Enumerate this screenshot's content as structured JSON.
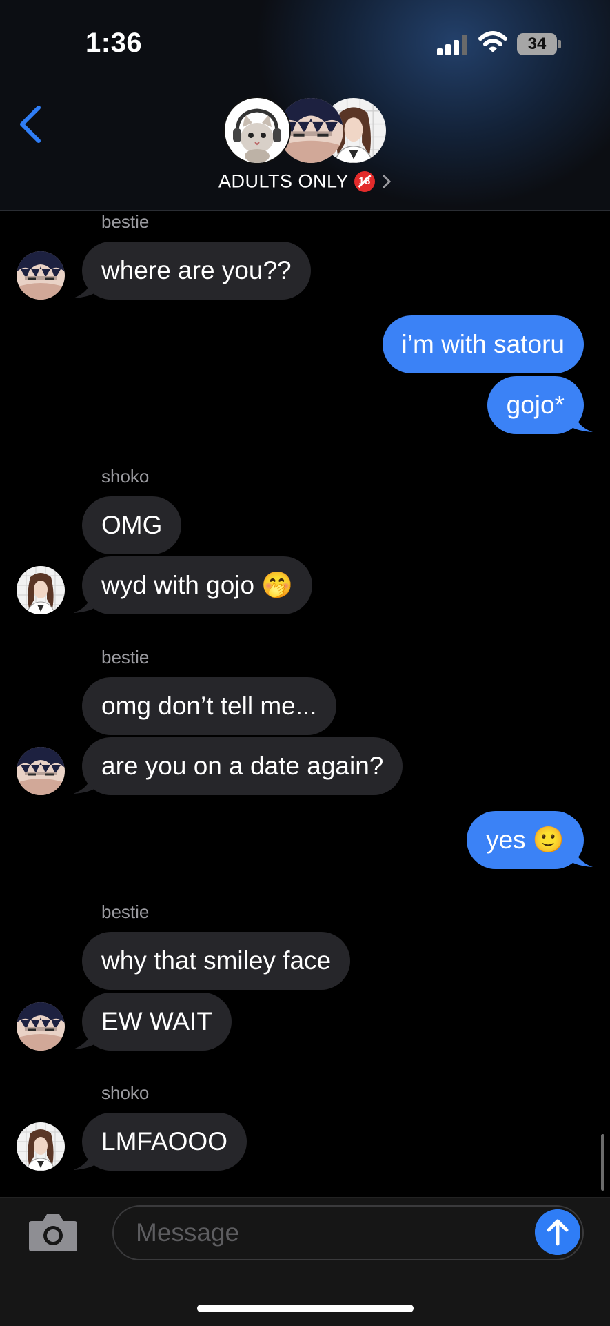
{
  "status_bar": {
    "time": "1:36",
    "battery": "34"
  },
  "header": {
    "title": "ADULTS ONLY",
    "badge": "18"
  },
  "messages": [
    {
      "sender": "bestie",
      "texts": [
        "where are you??"
      ]
    },
    {
      "sender": "me",
      "texts": [
        "i’m with satoru",
        "gojo*"
      ]
    },
    {
      "sender": "shoko",
      "texts": [
        "OMG",
        "wyd with gojo 🤭"
      ]
    },
    {
      "sender": "bestie",
      "texts": [
        "omg don’t tell me...",
        "are you on a date again?"
      ]
    },
    {
      "sender": "me",
      "texts": [
        "yes 🙂"
      ]
    },
    {
      "sender": "bestie",
      "texts": [
        "why that smiley face",
        "EW WAIT"
      ]
    },
    {
      "sender": "shoko",
      "texts": [
        "LMFAOOO"
      ]
    }
  ],
  "composer": {
    "placeholder": "Message"
  },
  "colors": {
    "outgoing": "#3b82f6",
    "incoming": "#26262a",
    "accent": "#2f7df6"
  },
  "icons": [
    "back-chevron-icon",
    "camera-icon",
    "send-arrow-icon",
    "signal-icon",
    "wifi-icon",
    "battery-icon"
  ]
}
